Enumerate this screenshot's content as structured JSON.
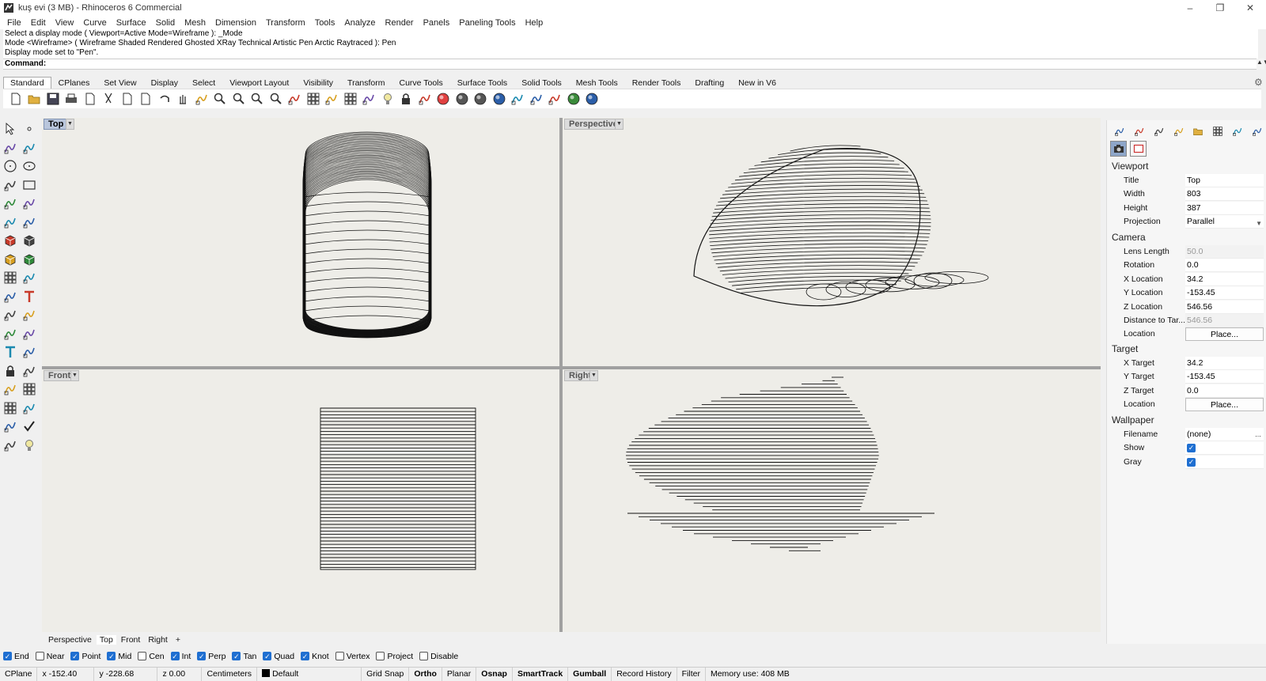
{
  "window": {
    "title": "kuş evi (3 MB) - Rhinoceros 6 Commercial",
    "controls": {
      "minimize": "–",
      "restore": "❐",
      "close": "✕"
    }
  },
  "menu": [
    "File",
    "Edit",
    "View",
    "Curve",
    "Surface",
    "Solid",
    "Mesh",
    "Dimension",
    "Transform",
    "Tools",
    "Analyze",
    "Render",
    "Panels",
    "Paneling Tools",
    "Help"
  ],
  "command": {
    "history": [
      "Select a display mode ( Viewport=Active  Mode=Wireframe ): _Mode",
      "Mode <Wireframe> ( Wireframe  Shaded  Rendered  Ghosted  XRay  Technical  Artistic  Pen  Arctic  Raytraced ): Pen",
      "Display mode set to \"Pen\"."
    ],
    "prompt": "Command:"
  },
  "toolbar_tabs": [
    "Standard",
    "CPlanes",
    "Set View",
    "Display",
    "Select",
    "Viewport Layout",
    "Visibility",
    "Transform",
    "Curve Tools",
    "Surface Tools",
    "Solid Tools",
    "Mesh Tools",
    "Render Tools",
    "Drafting",
    "New in V6"
  ],
  "toolbar_active_tab": "Standard",
  "toolbar_icons": [
    "new-file-icon",
    "open-icon",
    "save-icon",
    "print-icon",
    "import-icon",
    "cut-icon",
    "copy-icon",
    "paste-icon",
    "undo-icon",
    "pan-icon",
    "move-view-icon",
    "zoom-in-icon",
    "zoom-window-icon",
    "zoom-extents-icon",
    "zoom-selected-icon",
    "rotate-view-icon",
    "four-viewports-icon",
    "cplane-icon",
    "grid-icon",
    "osnap-icon",
    "light-bulb-icon",
    "lock-icon",
    "layer-icon",
    "color-wheel-icon",
    "shaded-sphere-icon",
    "rendered-sphere-icon",
    "render-icon",
    "filter-icon",
    "gear-icon",
    "tools-icon",
    "globe-icon",
    "help-icon"
  ],
  "left_palette_icons": [
    "select-arrow-icon",
    "point-icon",
    "polyline-icon",
    "curve-edit-icon",
    "circle-icon",
    "ellipse-icon",
    "arc-icon",
    "rectangle-icon",
    "polygon-icon",
    "curve-icon",
    "surface-icon",
    "surface-edit-icon",
    "box-icon",
    "boolean-icon",
    "extrude-icon",
    "solid-edit-icon",
    "array-icon",
    "transform-icon",
    "dimension-icon",
    "text-icon",
    "mesh-icon",
    "mesh-edit-icon",
    "fillet-icon",
    "blend-icon",
    "text-object-icon",
    "scale-icon",
    "block-icon",
    "group-icon",
    "cage-icon",
    "layout-icon",
    "grid-array-icon",
    "history-icon",
    "analyze-icon",
    "check-icon",
    "render-tools-icon",
    "light-icon"
  ],
  "viewports": [
    {
      "name": "Top",
      "active": true
    },
    {
      "name": "Perspective",
      "active": false
    },
    {
      "name": "Front",
      "active": false
    },
    {
      "name": "Right",
      "active": false
    }
  ],
  "viewport_tabs": [
    "Perspective",
    "Top",
    "Front",
    "Right"
  ],
  "viewport_tabs_active": "Top",
  "viewport_tabs_add": "+",
  "properties": {
    "tab_icons": [
      "color-icon",
      "material-icon",
      "display-icon",
      "pen-icon",
      "folder-icon",
      "layout-icon",
      "monitor-icon",
      "settings-icon"
    ],
    "sub_icons": [
      "camera-icon",
      "frame-icon"
    ],
    "viewport_section": "Viewport",
    "viewport": [
      {
        "label": "Title",
        "value": "Top"
      },
      {
        "label": "Width",
        "value": "803"
      },
      {
        "label": "Height",
        "value": "387"
      },
      {
        "label": "Projection",
        "value": "Parallel"
      }
    ],
    "camera_section": "Camera",
    "camera": [
      {
        "label": "Lens Length",
        "value": "50.0"
      },
      {
        "label": "Rotation",
        "value": "0.0"
      },
      {
        "label": "X Location",
        "value": "34.2"
      },
      {
        "label": "Y Location",
        "value": "-153.45"
      },
      {
        "label": "Z Location",
        "value": "546.56"
      },
      {
        "label": "Distance to Tar...",
        "value": "546.56"
      },
      {
        "label": "Location",
        "value": "Place..."
      }
    ],
    "target_section": "Target",
    "target": [
      {
        "label": "X Target",
        "value": "34.2"
      },
      {
        "label": "Y Target",
        "value": "-153.45"
      },
      {
        "label": "Z Target",
        "value": "0.0"
      },
      {
        "label": "Location",
        "value": "Place..."
      }
    ],
    "wallpaper_section": "Wallpaper",
    "wallpaper": [
      {
        "label": "Filename",
        "value": "(none)"
      },
      {
        "label": "Show",
        "checked": true
      },
      {
        "label": "Gray",
        "checked": true
      }
    ],
    "dots": "..."
  },
  "osnaps": [
    {
      "label": "End",
      "on": true
    },
    {
      "label": "Near",
      "on": false
    },
    {
      "label": "Point",
      "on": true
    },
    {
      "label": "Mid",
      "on": true
    },
    {
      "label": "Cen",
      "on": false
    },
    {
      "label": "Int",
      "on": true
    },
    {
      "label": "Perp",
      "on": true
    },
    {
      "label": "Tan",
      "on": true
    },
    {
      "label": "Quad",
      "on": true
    },
    {
      "label": "Knot",
      "on": true
    },
    {
      "label": "Vertex",
      "on": false
    },
    {
      "label": "Project",
      "on": false
    },
    {
      "label": "Disable",
      "on": false
    }
  ],
  "status": {
    "cplane": "CPlane",
    "x": "x -152.40",
    "y": "y -228.68",
    "z": "z 0.00",
    "units": "Centimeters",
    "layer": "Default",
    "grid_snap": "Grid Snap",
    "ortho": "Ortho",
    "planar": "Planar",
    "osnap": "Osnap",
    "smarttrack": "SmartTrack",
    "gumball": "Gumball",
    "record_history": "Record History",
    "filter": "Filter",
    "memory": "Memory use: 408 MB"
  },
  "colors": {
    "viewport_bg": "#eeede8",
    "active_label": "#b9c6dc",
    "check_blue": "#1f6fd1"
  }
}
